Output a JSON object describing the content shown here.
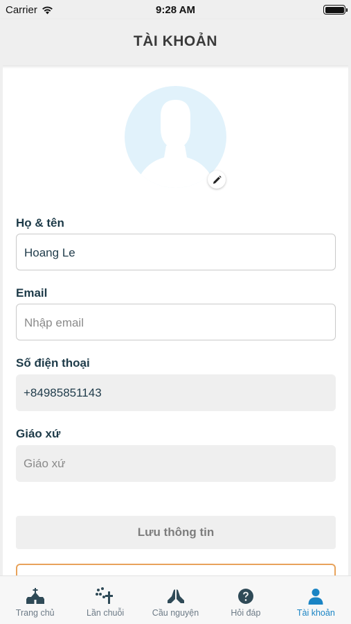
{
  "status_bar": {
    "carrier": "Carrier",
    "time": "9:28 AM"
  },
  "header": {
    "title": "TÀI KHOẢN"
  },
  "profile": {
    "avatar_icon": "person-silhouette-icon",
    "edit_icon": "pencil-icon"
  },
  "form": {
    "name": {
      "label": "Họ & tên",
      "value": "Hoang Le"
    },
    "email": {
      "label": "Email",
      "value": "",
      "placeholder": "Nhập email"
    },
    "phone": {
      "label": "Số điện thoại",
      "value": "+84985851143"
    },
    "parish": {
      "label": "Giáo xứ",
      "value": "",
      "placeholder": "Giáo xứ"
    }
  },
  "actions": {
    "save_label": "Lưu thông tin"
  },
  "tabs": [
    {
      "label": "Trang chủ",
      "icon": "church-icon",
      "active": false
    },
    {
      "label": "Lần chuỗi",
      "icon": "rosary-icon",
      "active": false
    },
    {
      "label": "Cầu nguyện",
      "icon": "praying-hands-icon",
      "active": false
    },
    {
      "label": "Hỏi đáp",
      "icon": "question-circle-icon",
      "active": false
    },
    {
      "label": "Tài khoản",
      "icon": "user-icon",
      "active": true
    }
  ],
  "colors": {
    "accent": "#1a84c4",
    "tab_inactive": "#2f4a57",
    "label_text": "#1d3a48",
    "avatar_bg": "#e1f2fb",
    "secondary_button_border": "#e8a25a"
  }
}
